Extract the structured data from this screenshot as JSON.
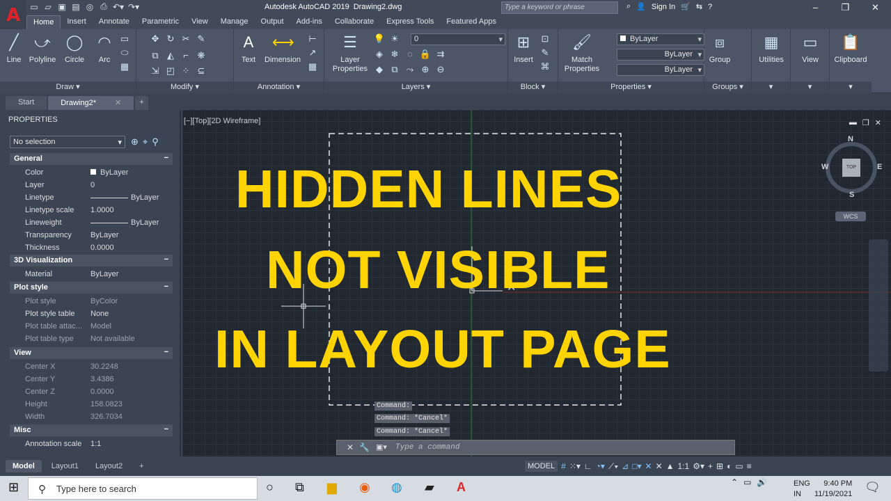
{
  "titlebar": {
    "app_title": "Autodesk AutoCAD 2019",
    "doc_title": "Drawing2.dwg",
    "search_placeholder": "Type a keyword or phrase",
    "sign_in": "Sign In"
  },
  "ribbon_tabs": [
    "Home",
    "Insert",
    "Annotate",
    "Parametric",
    "View",
    "Manage",
    "Output",
    "Add-ins",
    "Collaborate",
    "Express Tools",
    "Featured Apps"
  ],
  "ribbon": {
    "draw": {
      "title": "Draw",
      "buttons": [
        "Line",
        "Polyline",
        "Circle",
        "Arc"
      ]
    },
    "modify": {
      "title": "Modify"
    },
    "annotation": {
      "title": "Annotation",
      "buttons": [
        "Text",
        "Dimension"
      ]
    },
    "layers": {
      "title": "Layers",
      "button": "Layer Properties",
      "layer_combo": "0"
    },
    "block": {
      "title": "Block",
      "button": "Insert"
    },
    "properties": {
      "title": "Properties",
      "button": "Match Properties",
      "color": "ByLayer",
      "linetype": "ByLayer",
      "lineweight": "ByLayer"
    },
    "groups": {
      "title": "Groups",
      "button": "Group"
    },
    "utilities": "Utilities",
    "view": "View",
    "clipboard": "Clipboard"
  },
  "file_tabs": [
    "Start",
    "Drawing2*"
  ],
  "properties_palette": {
    "title": "PROPERTIES",
    "selection": "No selection",
    "sections": [
      {
        "name": "General",
        "rows": [
          [
            "Color",
            "ByLayer"
          ],
          [
            "Layer",
            "0"
          ],
          [
            "Linetype",
            "ByLayer"
          ],
          [
            "Linetype scale",
            "1.0000"
          ],
          [
            "Lineweight",
            "ByLayer"
          ],
          [
            "Transparency",
            "ByLayer"
          ],
          [
            "Thickness",
            "0.0000"
          ]
        ]
      },
      {
        "name": "3D Visualization",
        "rows": [
          [
            "Material",
            "ByLayer"
          ]
        ]
      },
      {
        "name": "Plot style",
        "rows": [
          [
            "Plot style",
            "ByColor"
          ],
          [
            "Plot style table",
            "None"
          ],
          [
            "Plot table attac...",
            "Model"
          ],
          [
            "Plot table type",
            "Not available"
          ]
        ]
      },
      {
        "name": "View",
        "rows": [
          [
            "Center X",
            "30.2248"
          ],
          [
            "Center Y",
            "3.4386"
          ],
          [
            "Center Z",
            "0.0000"
          ],
          [
            "Height",
            "158.0823"
          ],
          [
            "Width",
            "326.7034"
          ]
        ]
      },
      {
        "name": "Misc",
        "rows": [
          [
            "Annotation scale",
            "1:1"
          ]
        ]
      }
    ]
  },
  "viewport": {
    "label": "[−][Top][2D Wireframe]",
    "compass": {
      "n": "N",
      "s": "S",
      "e": "E",
      "w": "W",
      "top": "TOP",
      "wcs": "WCS"
    }
  },
  "headline": [
    "HIDDEN LINES",
    "NOT VISIBLE",
    "IN LAYOUT PAGE"
  ],
  "command": {
    "history": [
      "Command:",
      "Command: *Cancel*",
      "Command: *Cancel*"
    ],
    "placeholder": "Type a command"
  },
  "layout_tabs": [
    "Model",
    "Layout1",
    "Layout2"
  ],
  "status": {
    "model": "MODEL",
    "scale": "1:1"
  },
  "taskbar": {
    "search_placeholder": "Type here to search",
    "lang1": "ENG",
    "lang2": "IN",
    "time": "9:40 PM",
    "date": "11/19/2021"
  },
  "colors": {
    "accent": "#ffd400",
    "logo": "#e0232a",
    "viewport_bg": "#212830"
  }
}
